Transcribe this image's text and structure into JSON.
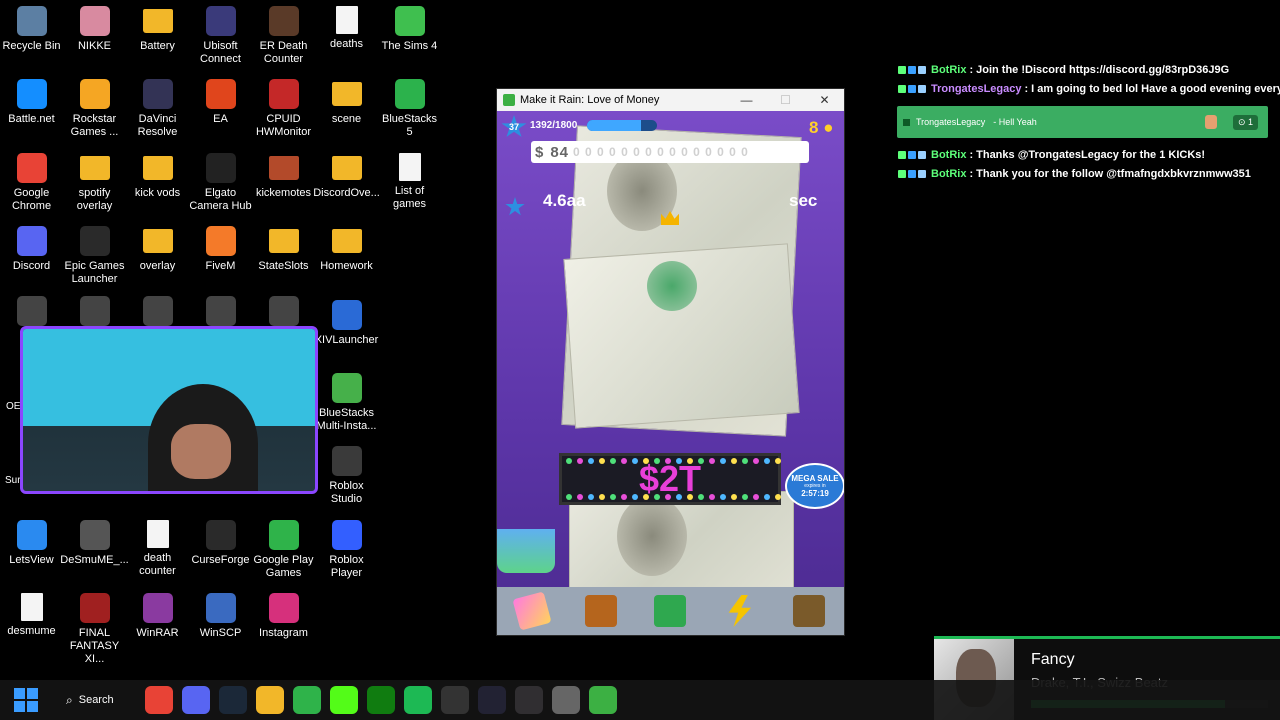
{
  "desktop": {
    "icons": [
      {
        "label": "Recycle Bin",
        "icon": "recycle-bin-icon",
        "color": "#5c7fa3"
      },
      {
        "label": "NIKKE",
        "icon": "nikke-icon",
        "color": "#d88aa0"
      },
      {
        "label": "Battery",
        "icon": "folder-icon",
        "color": "#f2b729"
      },
      {
        "label": "Ubisoft Connect",
        "icon": "ubisoft-icon",
        "color": "#3a3a7a"
      },
      {
        "label": "ER Death Counter",
        "icon": "er-death-counter-icon",
        "color": "#5a3a28"
      },
      {
        "label": "deaths",
        "icon": "text-file-icon",
        "color": "#eeeeee"
      },
      {
        "label": "The Sims 4",
        "icon": "sims-icon",
        "color": "#3fbf4f"
      },
      {
        "label": "Battle.net",
        "icon": "battlenet-icon",
        "color": "#148eff"
      },
      {
        "label": "Rockstar Games ...",
        "icon": "rockstar-icon",
        "color": "#f5a623"
      },
      {
        "label": "DaVinci Resolve",
        "icon": "davinci-icon",
        "color": "#333355"
      },
      {
        "label": "EA",
        "icon": "ea-icon",
        "color": "#e0451c"
      },
      {
        "label": "CPUID HWMonitor",
        "icon": "hwmonitor-icon",
        "color": "#c42828"
      },
      {
        "label": "scene",
        "icon": "folder-icon",
        "color": "#f2b729"
      },
      {
        "label": "BlueStacks 5",
        "icon": "bluestacks-icon",
        "color": "#2cb24c"
      },
      {
        "label": "Google Chrome",
        "icon": "chrome-icon",
        "color": "#e84336"
      },
      {
        "label": "spotify overlay",
        "icon": "folder-icon",
        "color": "#f2b729"
      },
      {
        "label": "kick vods",
        "icon": "folder-icon",
        "color": "#f2b729"
      },
      {
        "label": "Elgato Camera Hub",
        "icon": "elgato-icon",
        "color": "#222222"
      },
      {
        "label": "kickemotes",
        "icon": "folder-icon",
        "color": "#b34a2a"
      },
      {
        "label": "DiscordOve...",
        "icon": "folder-icon",
        "color": "#f2b729"
      },
      {
        "label": "List of games",
        "icon": "text-file-icon",
        "color": "#eeeeee"
      },
      {
        "label": "Discord",
        "icon": "discord-icon",
        "color": "#5865f2"
      },
      {
        "label": "Epic Games Launcher",
        "icon": "epic-games-icon",
        "color": "#2a2a2a"
      },
      {
        "label": "overlay",
        "icon": "folder-icon",
        "color": "#f2b729"
      },
      {
        "label": "FiveM",
        "icon": "fivem-icon",
        "color": "#f47a29"
      },
      {
        "label": "StateSlots",
        "icon": "folder-icon",
        "color": "#f2b729"
      },
      {
        "label": "Homework",
        "icon": "folder-icon",
        "color": "#f2b729"
      },
      {
        "label": "XIVLauncher",
        "icon": "xivlauncher-icon",
        "color": "#2a6ad6"
      },
      {
        "label": "BlueStacks Multi-Insta...",
        "icon": "bluestacks-multi-icon",
        "color": "#46b04a"
      },
      {
        "label": "Roblox Studio",
        "icon": "roblox-studio-icon",
        "color": "#3a3a3a"
      },
      {
        "label": "LetsView",
        "icon": "letsview-icon",
        "color": "#2a8af0"
      },
      {
        "label": "DeSmuME_...",
        "icon": "desmume-icon",
        "color": "#555555"
      },
      {
        "label": "death counter",
        "icon": "text-file-icon",
        "color": "#eeeeee"
      },
      {
        "label": "CurseForge",
        "icon": "curseforge-icon",
        "color": "#2a2a2a"
      },
      {
        "label": "Google Play Games",
        "icon": "google-play-games-icon",
        "color": "#2fb34a"
      },
      {
        "label": "Roblox Player",
        "icon": "roblox-player-icon",
        "color": "#335fff"
      },
      {
        "label": "desmume",
        "icon": "text-file-icon",
        "color": "#eeeeee"
      },
      {
        "label": "FINAL FANTASY XI...",
        "icon": "final-fantasy-icon",
        "color": "#a02020"
      },
      {
        "label": "WinRAR",
        "icon": "winrar-icon",
        "color": "#8a3aa0"
      },
      {
        "label": "WinSCP",
        "icon": "winscp-icon",
        "color": "#3a6ac0"
      },
      {
        "label": "Instagram",
        "icon": "instagram-icon",
        "color": "#d6307c"
      }
    ],
    "partial_labels": [
      "OE",
      "Sur"
    ]
  },
  "game_window": {
    "title": "Make it Rain: Love of Money",
    "controls": {
      "minimize": "—",
      "maximize": "☐",
      "close": "✕"
    },
    "level": "37",
    "xp_text": "1392/1800",
    "xp_progress": 0.77,
    "money_prefix": "$",
    "money_value": "84",
    "money_rest": "0 0 0 0 0 0 0 0 0 0 0 0 0 0 0",
    "rate_value": "4.6aa",
    "rate_suffix": "sec",
    "coins": "8",
    "marquee": "$2T",
    "mega_sale": {
      "title": "MEGA SALE",
      "subtitle": "expires in",
      "countdown": "2:57:19"
    }
  },
  "chat": {
    "messages": [
      {
        "user": "BotRix",
        "user_color": "#5dff7a",
        "text": "Join the !Discord https://discord.gg/83rpD36J9G"
      },
      {
        "user": "TrongatesLegacy",
        "user_color": "#c98cff",
        "text": "I am going to bed lol Have a good evening everyone"
      },
      {
        "user": "BotRix",
        "user_color": "#5dff7a",
        "text": "Thanks @TrongatesLegacy for the 1 KICKs!"
      },
      {
        "user": "BotRix",
        "user_color": "#5dff7a",
        "text": "Thank you for the follow @tfmafngdxbkvrznmww351"
      }
    ],
    "highlight": {
      "user": "TrongatesLegacy",
      "text": "- Hell Yeah",
      "count": "1"
    }
  },
  "now_playing": {
    "title": "Fancy",
    "artist": "Drake, T.I., Swizz Beatz",
    "progress": 0.82
  },
  "taskbar": {
    "search_label": "Search",
    "apps": [
      {
        "icon": "chrome-icon",
        "color": "#e84336"
      },
      {
        "icon": "discord-icon",
        "color": "#5865f2"
      },
      {
        "icon": "steam-icon",
        "color": "#1b2838"
      },
      {
        "icon": "file-explorer-icon",
        "color": "#f2b729"
      },
      {
        "icon": "green-app-icon",
        "color": "#2fb34a"
      },
      {
        "icon": "kick-icon",
        "color": "#53fc18"
      },
      {
        "icon": "xbox-icon",
        "color": "#107c10"
      },
      {
        "icon": "spotify-icon",
        "color": "#1db954"
      },
      {
        "icon": "elgato-icon",
        "color": "#333333"
      },
      {
        "icon": "stream-deck-icon",
        "color": "#222233"
      },
      {
        "icon": "obs-icon",
        "color": "#302e31"
      },
      {
        "icon": "settings-icon",
        "color": "#666666"
      },
      {
        "icon": "make-it-rain-icon",
        "color": "#3cb043"
      }
    ]
  }
}
